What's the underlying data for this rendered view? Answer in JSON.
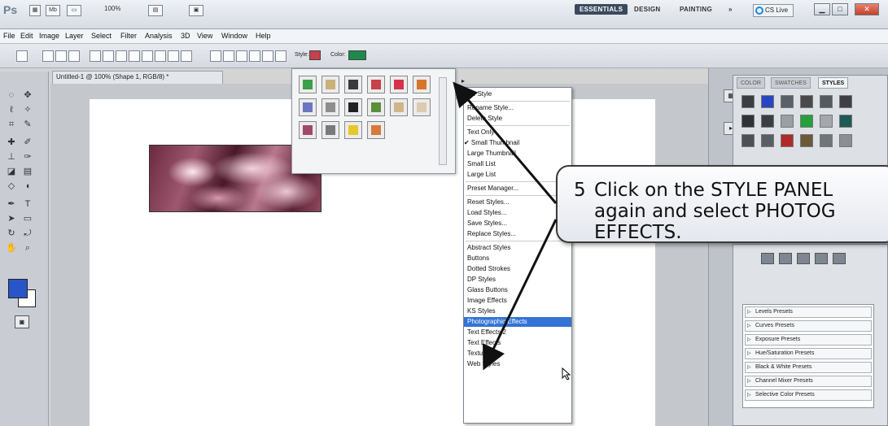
{
  "app": {
    "logo": "Ps",
    "zoom": "100%",
    "workspaces": [
      "ESSENTIALS",
      "DESIGN",
      "PAINTING"
    ],
    "more": "»",
    "cs_live": "CS Live"
  },
  "menus": [
    "File",
    "Edit",
    "Image",
    "Layer",
    "Select",
    "Filter",
    "Analysis",
    "3D",
    "View",
    "Window",
    "Help"
  ],
  "options": {
    "style_label": "Style:",
    "color_label": "Color:",
    "color_value": "#1c8a4a"
  },
  "document": {
    "tab_title": "Untitled-1 @ 100% (Shape 1, RGB/8) *"
  },
  "style_picker": {
    "swatches": [
      "#3aa04a",
      "#c9b27a",
      "#3a3a3a",
      "#c7404a",
      "#d6324a",
      "#d8742a",
      "#6a77c0",
      "#8e8e8e",
      "#222222",
      "#5a8f3c",
      "#d0b48a",
      "#dccbb0",
      "#a04a6a",
      "#7a7a7a",
      "#e6c82a",
      "#d87a3a"
    ],
    "menu_button": "▸"
  },
  "flyout": {
    "items": [
      {
        "label": "No Style"
      },
      {
        "sep": true
      },
      {
        "label": "Rename Style..."
      },
      {
        "label": "Delete Style"
      },
      {
        "sep": true
      },
      {
        "label": "Text Only"
      },
      {
        "label": "Small Thumbnail",
        "checked": true
      },
      {
        "label": "Large Thumbnail"
      },
      {
        "label": "Small List"
      },
      {
        "label": "Large List"
      },
      {
        "sep": true
      },
      {
        "label": "Preset Manager..."
      },
      {
        "sep": true
      },
      {
        "label": "Reset Styles..."
      },
      {
        "label": "Load Styles..."
      },
      {
        "label": "Save Styles..."
      },
      {
        "label": "Replace Styles..."
      },
      {
        "sep": true
      },
      {
        "label": "Abstract Styles"
      },
      {
        "label": "Buttons"
      },
      {
        "label": "Dotted Strokes"
      },
      {
        "label": "DP Styles"
      },
      {
        "label": "Glass Buttons"
      },
      {
        "label": "Image Effects"
      },
      {
        "label": "KS Styles"
      },
      {
        "label": "Photographic Effects",
        "highlight": true
      },
      {
        "label": "Text Effects 2"
      },
      {
        "label": "Text Effects"
      },
      {
        "label": "Textures"
      },
      {
        "label": "Web Styles"
      }
    ]
  },
  "panels": {
    "tabs": [
      "COLOR",
      "SWATCHES",
      "STYLES"
    ],
    "style_swatches": [
      "#3a3f46",
      "#2a45c0",
      "#5a6068",
      "#4a4a4a",
      "#555a60",
      "#3f3f44",
      "#2f3338",
      "#3a3f46",
      "#9aa0a8",
      "#25a03a",
      "#a4a8ae",
      "#1f5a56",
      "#4c5158",
      "#5a5f66",
      "#b02a2a",
      "#6a5a3a",
      "#70757c",
      "#8a8f96"
    ],
    "adjust_presets": [
      "Levels Presets",
      "Curves Presets",
      "Exposure Presets",
      "Hue/Saturation Presets",
      "Black & White Presets",
      "Channel Mixer Presets",
      "Selective Color Presets"
    ]
  },
  "callout": {
    "number": "5",
    "lines": [
      "Click on the STYLE PANEL",
      "again and select PHOTOG",
      "EFFECTS."
    ]
  }
}
